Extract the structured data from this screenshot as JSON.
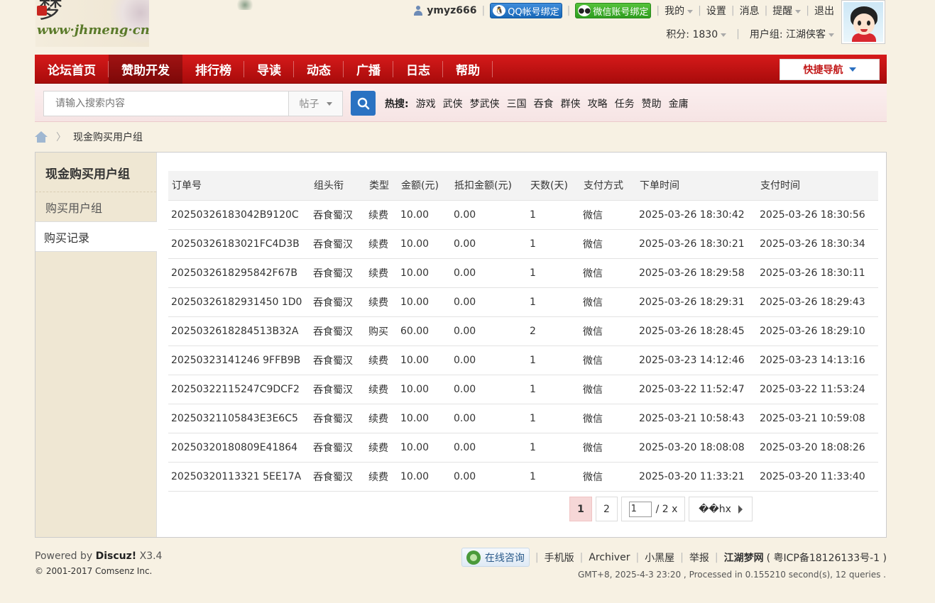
{
  "header": {
    "logo_text": "www·jhmeng·cn",
    "logo_char": "梦",
    "username": "ymyz666",
    "qq_bind": "QQ帐号绑定",
    "wx_bind": "微信账号绑定",
    "menu": [
      "我的",
      "设置",
      "消息",
      "提醒",
      "退出"
    ],
    "points_label": "积分: 1830",
    "group_label": "用户组: 江湖侠客"
  },
  "nav": {
    "items": [
      "论坛首页",
      "赞助开发",
      "排行榜",
      "导读",
      "动态",
      "广播",
      "日志",
      "帮助"
    ],
    "active_index": 1,
    "quick_nav": "快捷导航"
  },
  "search": {
    "placeholder": "请输入搜索内容",
    "type": "帖子",
    "hot_label": "热搜:",
    "hot_items": [
      "游戏",
      "武侠",
      "梦武侠",
      "三国",
      "吞食",
      "群侠",
      "攻略",
      "任务",
      "赞助",
      "金庸"
    ]
  },
  "breadcrumb": {
    "current": "现金购买用户组",
    "separator": "〉"
  },
  "sidebar": {
    "title": "现金购买用户组",
    "items": [
      "购买用户组",
      "购买记录"
    ],
    "active_index": 1
  },
  "table": {
    "headers": [
      "订单号",
      "组头衔",
      "类型",
      "金额(元)",
      "抵扣金额(元)",
      "天数(天)",
      "支付方式",
      "下单时间",
      "支付时间"
    ],
    "rows": [
      [
        "20250326183042B9120C",
        "吞食蜀汉",
        "续费",
        "10.00",
        "0.00",
        "1",
        "微信",
        "2025-03-26 18:30:42",
        "2025-03-26 18:30:56"
      ],
      [
        "20250326183021FC4D3B",
        "吞食蜀汉",
        "续费",
        "10.00",
        "0.00",
        "1",
        "微信",
        "2025-03-26 18:30:21",
        "2025-03-26 18:30:34"
      ],
      [
        "2025032618295842F67B",
        "吞食蜀汉",
        "续费",
        "10.00",
        "0.00",
        "1",
        "微信",
        "2025-03-26 18:29:58",
        "2025-03-26 18:30:11"
      ],
      [
        "20250326182931450 1D0",
        "吞食蜀汉",
        "续费",
        "10.00",
        "0.00",
        "1",
        "微信",
        "2025-03-26 18:29:31",
        "2025-03-26 18:29:43"
      ],
      [
        "2025032618284513B32A",
        "吞食蜀汉",
        "购买",
        "60.00",
        "0.00",
        "2",
        "微信",
        "2025-03-26 18:28:45",
        "2025-03-26 18:29:10"
      ],
      [
        "20250323141246 9FFB9B",
        "吞食蜀汉",
        "续费",
        "10.00",
        "0.00",
        "1",
        "微信",
        "2025-03-23 14:12:46",
        "2025-03-23 14:13:16"
      ],
      [
        "20250322115247C9DCF2",
        "吞食蜀汉",
        "续费",
        "10.00",
        "0.00",
        "1",
        "微信",
        "2025-03-22 11:52:47",
        "2025-03-22 11:53:24"
      ],
      [
        "20250321105843E3E6C5",
        "吞食蜀汉",
        "续费",
        "10.00",
        "0.00",
        "1",
        "微信",
        "2025-03-21 10:58:43",
        "2025-03-21 10:59:08"
      ],
      [
        "20250320180809E41864",
        "吞食蜀汉",
        "续费",
        "10.00",
        "0.00",
        "1",
        "微信",
        "2025-03-20 18:08:08",
        "2025-03-20 18:08:26"
      ],
      [
        "20250320113321 5EE17A",
        "吞食蜀汉",
        "续费",
        "10.00",
        "0.00",
        "1",
        "微信",
        "2025-03-20 11:33:21",
        "2025-03-20 11:33:40"
      ]
    ]
  },
  "pager": {
    "current": "1",
    "next_page": "2",
    "jump_value": "1",
    "total": "/ 2 x",
    "next_label": "��hx"
  },
  "footer": {
    "powered_prefix": "Powered by ",
    "powered_brand": "Discuz!",
    "powered_version": " X3.4",
    "copyright": "© 2001-2017 Comsenz Inc.",
    "online": "在线咨询",
    "links": [
      "手机版",
      "Archiver",
      "小黑屋",
      "举报"
    ],
    "site_name": "江湖梦网",
    "icp": "( 粤ICP备18126133号-1 )",
    "meta": "GMT+8, 2025-4-3 23:20 , Processed in 0.155210 second(s), 12 queries ."
  },
  "colors": {
    "nav_red": "#c21414",
    "accent_blue": "#2a72c2",
    "page_bg": "#f7f1e3"
  }
}
